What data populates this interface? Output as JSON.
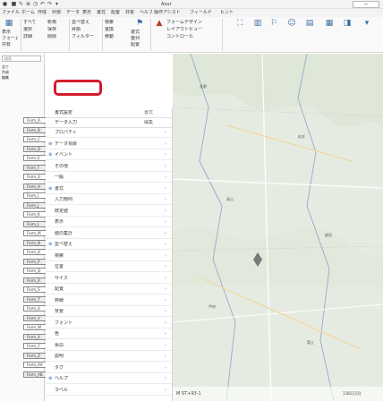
{
  "titlebar": {
    "quick_access": [
      "●",
      "■",
      "✎",
      "⊕",
      "◷",
      "↶",
      "↷",
      "▾"
    ],
    "title": "Axur",
    "right_label": "—"
  },
  "tabs": [
    "ファイル",
    "ホーム",
    "作成",
    "外部",
    "データ",
    "表示",
    "書式",
    "配置",
    "共有",
    "ヘルプ",
    "操作アシスト",
    "フィールド",
    "ヒント"
  ],
  "ribbon": {
    "group1": [
      "表示",
      "フォーム",
      "共有"
    ],
    "group2_row1": "すべて",
    "group2_row2": "選択",
    "group2_row3": "詳細",
    "group3_row1": "新規",
    "group3_row2": "保存",
    "group3_row3": "削除",
    "group4_row1": "並べ替え",
    "group4_row2": "昇順",
    "group4_row3": "フィルター",
    "group5_row1": "検索",
    "group5_row2": "置換",
    "group5_row3": "移動",
    "group6": [
      "書式",
      "整列",
      "配置"
    ],
    "cmd1": "フォームデザイン",
    "cmd2": "レイアウトビュー",
    "cmd3": "コントロール"
  },
  "leftpanel": {
    "header_input": "検索",
    "small_labels": [
      "全て",
      "作成",
      "編集"
    ],
    "form_rows": [
      "Form_A",
      "Form_B",
      "Form_C",
      "Form_D",
      "Form_E",
      "Form_F",
      "Form_G",
      "Form_H",
      "Form_I",
      "Form_J",
      "Form_K",
      "Form_L",
      "Form_M",
      "Form_N",
      "Form_O",
      "Form_P",
      "Form_Q",
      "Form_R",
      "Form_S",
      "Form_T",
      "Form_U",
      "Form_V",
      "Form_W",
      "Form_X",
      "Form_Y",
      "Form_Z",
      "Form_AA",
      "Form_AB"
    ]
  },
  "proppanel": {
    "header_rows": [
      "書式設定",
      "データ入力"
    ],
    "header_right": [
      "書式",
      "編集"
    ],
    "rows": [
      {
        "label": "プロパティ",
        "icon": ""
      },
      {
        "label": "データ項目",
        "icon": "⊕"
      },
      {
        "label": "イベント",
        "icon": "⊕"
      },
      {
        "label": "その他",
        "icon": ""
      },
      {
        "label": "一般",
        "icon": ""
      },
      {
        "label": "書式",
        "icon": "⊕"
      },
      {
        "label": "入力規則",
        "icon": ""
      },
      {
        "label": "既定値",
        "icon": ""
      },
      {
        "label": "表示",
        "icon": ""
      },
      {
        "label": "値の集計",
        "icon": ""
      },
      {
        "label": "並べ替え",
        "icon": "⊕"
      },
      {
        "label": "検索",
        "icon": ""
      },
      {
        "label": "位置",
        "icon": ""
      },
      {
        "label": "サイズ",
        "icon": ""
      },
      {
        "label": "配置",
        "icon": ""
      },
      {
        "label": "枠線",
        "icon": ""
      },
      {
        "label": "背景",
        "icon": ""
      },
      {
        "label": "フォント",
        "icon": ""
      },
      {
        "label": "色",
        "icon": ""
      },
      {
        "label": "余白",
        "icon": ""
      },
      {
        "label": "説明",
        "icon": ""
      },
      {
        "label": "タグ",
        "icon": ""
      },
      {
        "label": "ヘルプ",
        "icon": "⊕"
      },
      {
        "label": "ラベル",
        "icon": ""
      }
    ]
  },
  "map": {
    "bottom_left": "M ST+93-1",
    "bottom_right": "1382万5月",
    "labels": [
      "長野",
      "松本",
      "高山",
      "飯田",
      "甲府",
      "富士"
    ]
  },
  "colors": {
    "highlight": "#d21d2a",
    "accent": "#3a6ea5"
  }
}
